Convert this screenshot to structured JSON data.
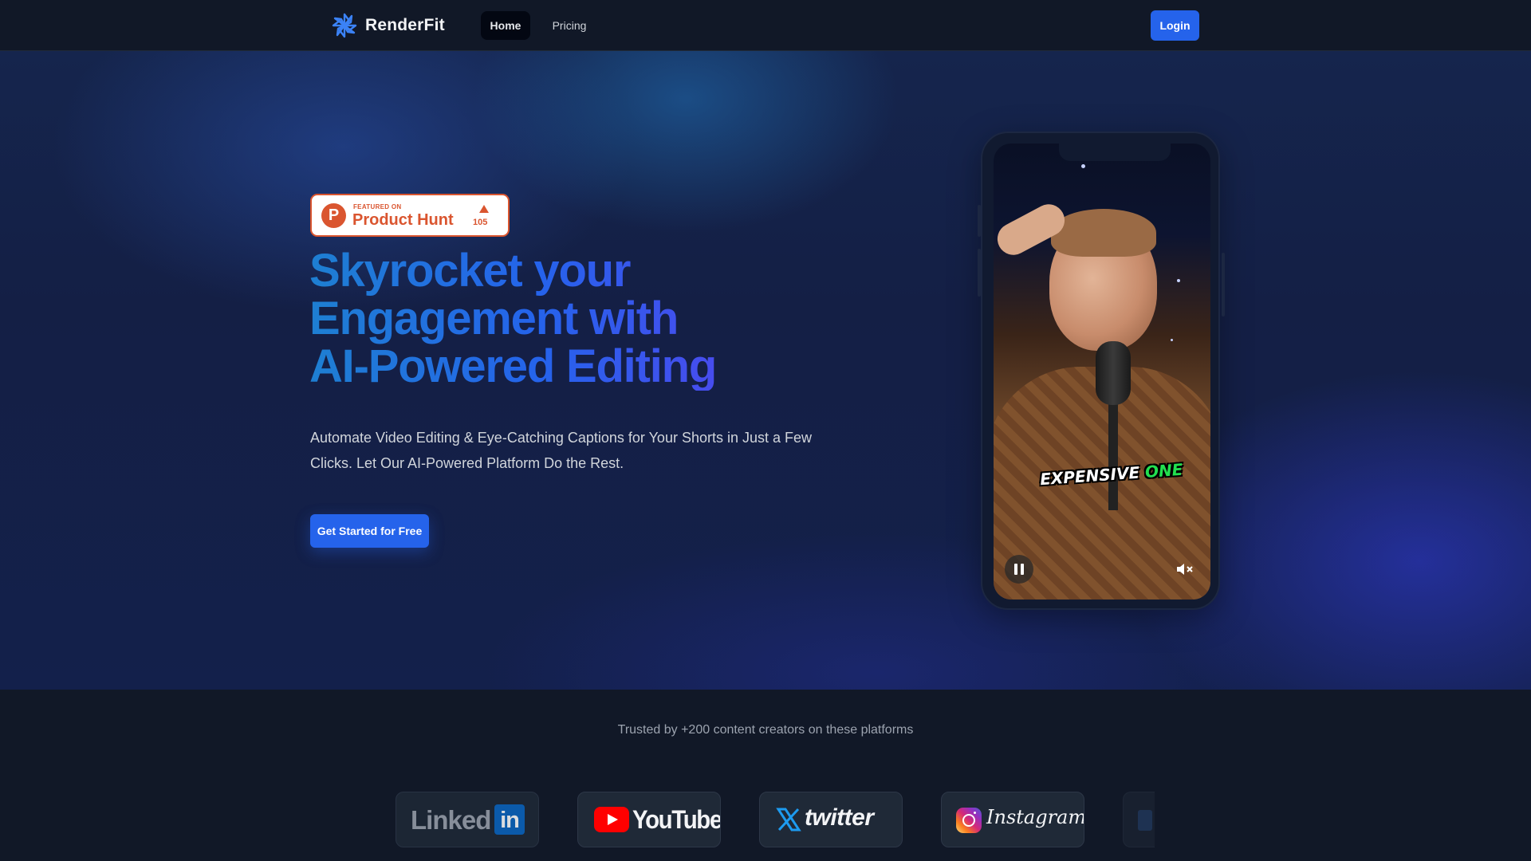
{
  "nav": {
    "brand": "RenderFit",
    "links": [
      {
        "label": "Home",
        "active": true
      },
      {
        "label": "Pricing",
        "active": false
      }
    ],
    "login_label": "Login"
  },
  "hero": {
    "badge": {
      "small": "FEATURED ON",
      "title": "Product Hunt",
      "upvotes": "105"
    },
    "headline_lines": [
      "Skyrocket your",
      "Engagement with",
      "AI-Powered Editing"
    ],
    "subtitle": "Automate Video Editing & Eye-Catching Captions for Your Shorts in Just a Few Clicks. Let Our AI-Powered Platform Do the Rest.",
    "cta_label": "Get Started for Free"
  },
  "video": {
    "caption_white": "EXPENSIVE",
    "caption_green": "ONE"
  },
  "trusted": {
    "text": "Trusted by +200 content creators on these platforms",
    "platforms": {
      "linkedin": {
        "word": "Linked",
        "box": "in"
      },
      "youtube": {
        "word": "YouTube"
      },
      "twitter": {
        "word": "twitter"
      },
      "instagram": {
        "word": "Instagram"
      }
    }
  },
  "colors": {
    "accent": "#2563eb",
    "producthunt": "#da552f",
    "caption_green": "#22e04f"
  }
}
